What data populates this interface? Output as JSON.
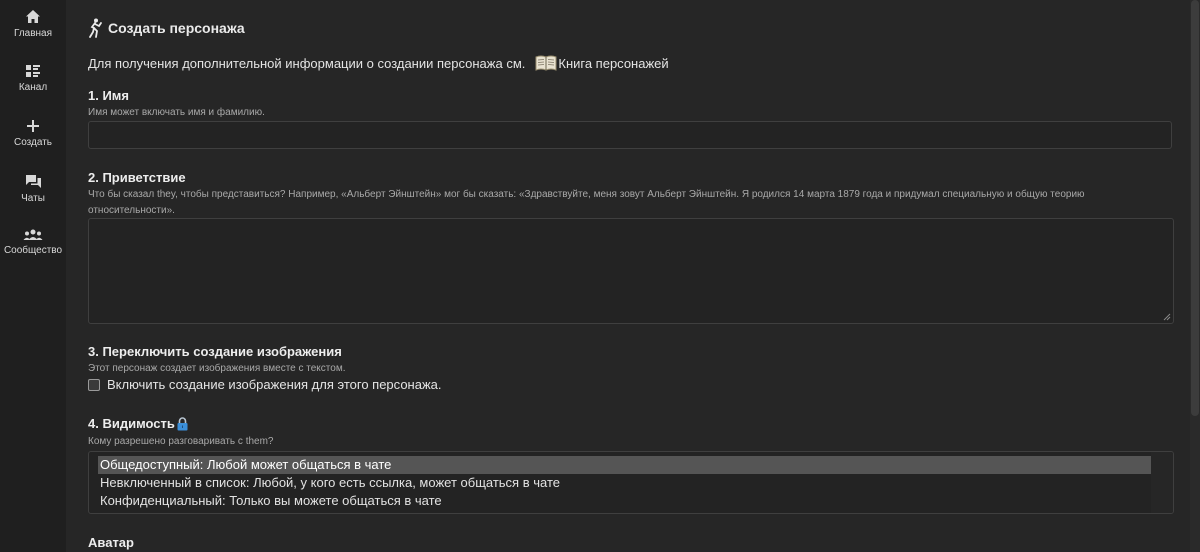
{
  "sidebar": {
    "items": [
      {
        "label": "Главная",
        "icon": "home-icon"
      },
      {
        "label": "Канал",
        "icon": "feed-icon"
      },
      {
        "label": "Создать",
        "icon": "plus-icon"
      },
      {
        "label": "Чаты",
        "icon": "chat-icon"
      },
      {
        "label": "Сообщество",
        "icon": "community-icon"
      }
    ]
  },
  "page": {
    "title": "Создать персонажа",
    "title_icon": "dancer-icon",
    "info_text": "Для получения дополнительной информации о создании персонажа см.",
    "book_link": "Книга персонажей",
    "book_icon": "book-icon"
  },
  "sections": {
    "name": {
      "title": "1. Имя",
      "hint": "Имя может включать имя и фамилию.",
      "value": ""
    },
    "greeting": {
      "title": "2. Приветствие",
      "hint_line1": "Что бы сказал they, чтобы представиться? Например, «Альберт Эйнштейн» мог бы сказать: «Здравствуйте, меня зовут Альберт Эйнштейн. Я родился 14 марта 1879 года и придумал специальную и общую теорию",
      "hint_line2": "относительности».",
      "value": ""
    },
    "image_gen": {
      "title": "3. Переключить создание изображения",
      "hint": "Этот персонаж создает изображения вместе с текстом.",
      "checkbox_label": "Включить создание изображения для этого персонажа.",
      "checked": false
    },
    "visibility": {
      "title": "4. Видимость",
      "lock_icon": "lock-icon",
      "hint": "Кому разрешено разговаривать с them?",
      "options": [
        "Общедоступный: Любой может общаться в чате",
        "Невключенный в список: Любой, у кого есть ссылка, может общаться в чате",
        "Конфиденциальный: Только вы можете общаться в чате"
      ],
      "selected": "Общедоступный: Любой может общаться в чате"
    },
    "avatar": {
      "title": "Аватар"
    }
  },
  "colors": {
    "background": "#262626",
    "sidebar": "#1f1f1f",
    "input_bg": "#232323",
    "border": "#3f3f3f",
    "selected_option": "#555555",
    "lock_accent": "#3b8fd9"
  }
}
